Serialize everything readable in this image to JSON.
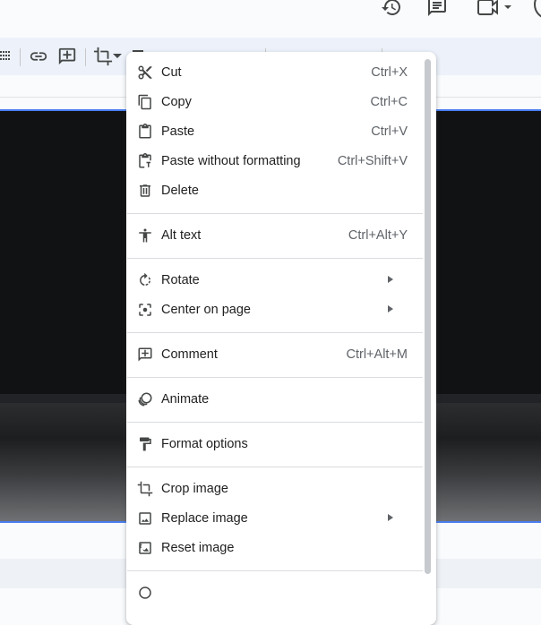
{
  "colors": {
    "accent": "#4a7df0",
    "menu_bg": "#ffffff",
    "text": "#1f1f1f",
    "shortcut": "#5f6368"
  },
  "topbar": {
    "icons": [
      "history-icon",
      "comment-history-icon",
      "meet-icon"
    ]
  },
  "toolbar": {
    "icons": [
      "align-icon",
      "link-icon",
      "add-comment-icon",
      "crop-icon",
      "chevron-down-icon",
      "mask-icon"
    ]
  },
  "context_menu": {
    "items": [
      {
        "label": "Cut",
        "shortcut": "Ctrl+X",
        "icon": "cut-icon"
      },
      {
        "label": "Copy",
        "shortcut": "Ctrl+C",
        "icon": "copy-icon"
      },
      {
        "label": "Paste",
        "shortcut": "Ctrl+V",
        "icon": "paste-icon"
      },
      {
        "label": "Paste without formatting",
        "shortcut": "Ctrl+Shift+V",
        "icon": "paste-plain-icon"
      },
      {
        "label": "Delete",
        "shortcut": "",
        "icon": "trash-icon"
      },
      {
        "label": "Alt text",
        "shortcut": "Ctrl+Alt+Y",
        "icon": "accessibility-icon"
      },
      {
        "label": "Rotate",
        "shortcut": "",
        "icon": "rotate-icon",
        "submenu": true
      },
      {
        "label": "Center on page",
        "shortcut": "",
        "icon": "center-focus-icon",
        "submenu": true
      },
      {
        "label": "Comment",
        "shortcut": "Ctrl+Alt+M",
        "icon": "add-comment-icon"
      },
      {
        "label": "Animate",
        "shortcut": "",
        "icon": "animate-icon"
      },
      {
        "label": "Format options",
        "shortcut": "",
        "icon": "format-paint-icon"
      },
      {
        "label": "Crop image",
        "shortcut": "",
        "icon": "crop-icon"
      },
      {
        "label": "Replace image",
        "shortcut": "",
        "icon": "replace-image-icon",
        "submenu": true
      },
      {
        "label": "Reset image",
        "shortcut": "",
        "icon": "reset-image-icon"
      }
    ]
  }
}
